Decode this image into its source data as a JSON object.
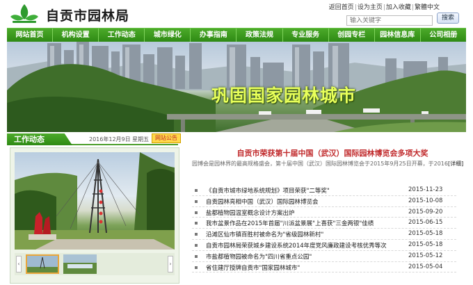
{
  "header": {
    "site_title": "自贡市园林局",
    "links": [
      "返回首页",
      "设为主页",
      "加入收藏",
      "繁體中文"
    ],
    "search": {
      "placeholder": "输入关键字",
      "button_label": "搜索"
    }
  },
  "nav": {
    "items": [
      "网站首页",
      "机构设置",
      "工作动态",
      "城市绿化",
      "办事指南",
      "政策法规",
      "专业服务",
      "创园专栏",
      "园林信息库",
      "公司相册"
    ]
  },
  "banner": {
    "slogan": "巩固国家园林城市"
  },
  "section": {
    "title": "工作动态",
    "date": "2016年12月9日 星期五",
    "announce_label": "网站公告"
  },
  "headline": {
    "title": "自贡市荣获第十届中国（武汉）国际园林博览会多项大奖",
    "summary": "园博会是园林界的最高规格盛会，第十届中国（武汉）国际园林博览会于2015年9月25日开幕，于2016",
    "detail_label": "[详细]"
  },
  "news": [
    {
      "title": "《自贡市城市绿地系统规划》项目荣获\"二等奖\"",
      "date": "2015-11-23"
    },
    {
      "title": "自贡园林亮相中国（武汉）国际园林博览会",
      "date": "2015-10-08"
    },
    {
      "title": "盐都植物园温室概念设计方案出炉",
      "date": "2015-09-20"
    },
    {
      "title": "我市盆景作品在2015年首届\"川派盆景展\"上喜获\"三金两银\"佳绩",
      "date": "2015-06-15"
    },
    {
      "title": "沿滩区仙市镇百胜村被命名为\"省级园林新村\"",
      "date": "2015-05-18"
    },
    {
      "title": "自贡市园林局荣获城乡建设系统2014年度党风廉政建设考核优秀等次",
      "date": "2015-05-18"
    },
    {
      "title": "市盐都植物园被命名为\"四川省重点公园\"",
      "date": "2015-05-12"
    },
    {
      "title": "省住建厅授牌自贡市\"国家园林城市\"",
      "date": "2015-05-04"
    }
  ],
  "colors": {
    "nav_green": "#2e8a14",
    "headline_red": "#c0282a",
    "slogan_yellow": "#e8ff5a"
  },
  "icons": {
    "logo": "green-leaf-logo-icon",
    "bullet": "square-bullet-icon"
  }
}
